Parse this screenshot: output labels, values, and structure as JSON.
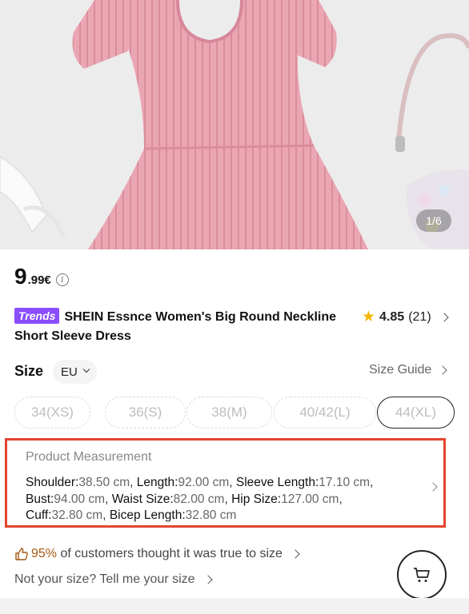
{
  "gallery": {
    "counter": "1/6"
  },
  "price": {
    "integer": "9",
    "decimal": ".99€"
  },
  "product": {
    "badge": "Trends",
    "title": "SHEIN Essnce Women's Big Round Neckline Short Sleeve Dress",
    "rating": "4.85",
    "reviews": "(21)"
  },
  "size": {
    "label": "Size",
    "region": "EU",
    "guide": "Size Guide",
    "options": [
      "34(XS)",
      "36(S)",
      "38(M)",
      "40/42(L)",
      "44(XL)"
    ],
    "selected": "44(XL)"
  },
  "measurement": {
    "title": "Product Measurement",
    "items": [
      {
        "label": "Shoulder:",
        "value": "38.50 cm"
      },
      {
        "label": "Length:",
        "value": "92.00 cm"
      },
      {
        "label": "Sleeve Length:",
        "value": "17.10 cm"
      },
      {
        "label": "Bust:",
        "value": "94.00 cm"
      },
      {
        "label": "Waist Size:",
        "value": "82.00 cm"
      },
      {
        "label": "Hip Size:",
        "value": "127.00 cm"
      },
      {
        "label": "Cuff:",
        "value": "32.80 cm"
      },
      {
        "label": "Bicep Length:",
        "value": "32.80 cm"
      }
    ]
  },
  "fit": {
    "percent": "95%",
    "text": "of customers thought it was true to size"
  },
  "not_your_size": "Not your size? Tell me your size",
  "colors": {
    "accent": "#e3452f",
    "trends": "#8a4dff",
    "star": "#f6b600",
    "dress": "#e9a7b4"
  },
  "icons": {
    "cart": "cart-icon",
    "thumb": "thumbs-up-icon",
    "star": "star-icon",
    "info": "info-icon"
  }
}
